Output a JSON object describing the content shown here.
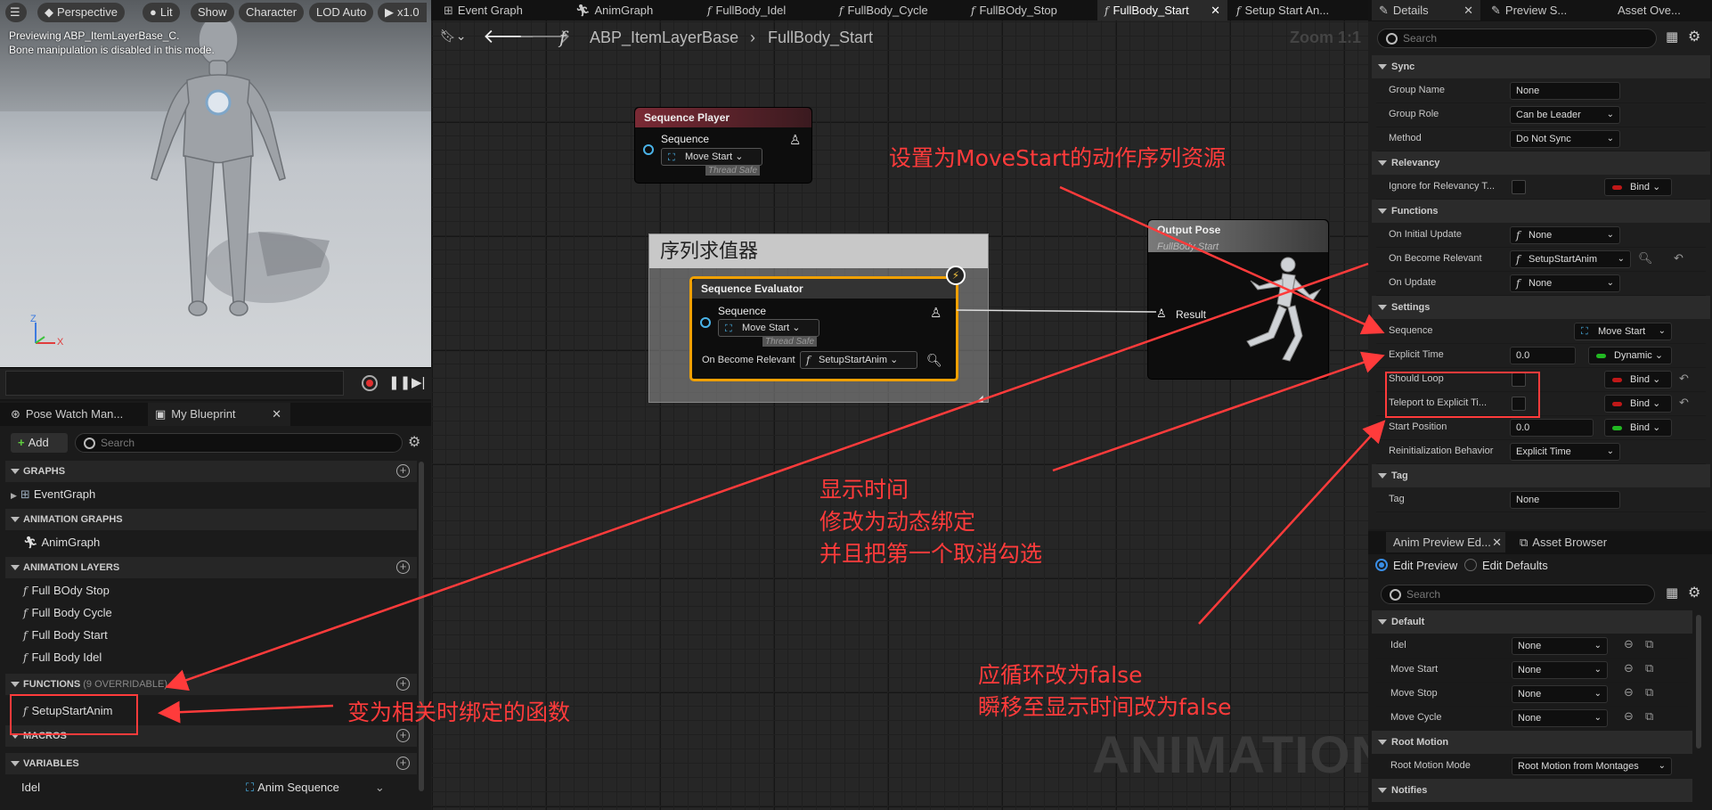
{
  "viewport": {
    "toolbar": [
      "Perspective",
      "Lit",
      "Show",
      "Character",
      "LOD Auto",
      "x1.0"
    ],
    "preview_line1": "Previewing ABP_ItemLayerBase_C.",
    "preview_line2": "Bone manipulation is disabled in this mode.",
    "axis_z": "Z",
    "axis_x": "X"
  },
  "left_panel": {
    "tabs": [
      "Pose Watch Man...",
      "My Blueprint"
    ],
    "add_label": "Add",
    "search_placeholder": "Search",
    "sections": {
      "graphs": "GRAPHS",
      "animation_graphs": "ANIMATION GRAPHS",
      "animation_layers": "ANIMATION LAYERS",
      "functions": "FUNCTIONS",
      "functions_note": "(9 OVERRIDABLE)",
      "macros": "MACROS",
      "variables": "VARIABLES"
    },
    "graphs": [
      "EventGraph"
    ],
    "animation_graphs": [
      "AnimGraph"
    ],
    "animation_layers": [
      "Full BOdy Stop",
      "Full Body Cycle",
      "Full Body Start",
      "Full Body Idel"
    ],
    "functions": [
      "SetupStartAnim"
    ],
    "variable": {
      "name": "Idel",
      "type": "Anim Sequence"
    }
  },
  "graph": {
    "tabs": [
      "Event Graph",
      "AnimGraph",
      "FullBody_Idel",
      "FullBody_Cycle",
      "FullBOdy_Stop",
      "FullBody_Start",
      "Setup Start An..."
    ],
    "breadcrumb": [
      "ABP_ItemLayerBase",
      "FullBody_Start"
    ],
    "zoom": "Zoom 1:1",
    "sequence_player": {
      "title": "Sequence Player",
      "pin": "Sequence",
      "value": "Move Start",
      "thread_safe": "Thread Safe"
    },
    "comment": "序列求值器",
    "evaluator": {
      "title": "Sequence Evaluator",
      "pin": "Sequence",
      "value": "Move Start",
      "thread_safe": "Thread Safe",
      "relevant_label": "On Become Relevant",
      "relevant_value": "SetupStartAnim"
    },
    "output_pose": {
      "title": "Output Pose",
      "subtitle": "FullBody Start",
      "pin": "Result"
    },
    "watermark": "ANIMATION"
  },
  "details": {
    "tabs": [
      "Details",
      "Preview S...",
      "Asset Ove..."
    ],
    "search_placeholder": "Search",
    "sync": {
      "header": "Sync",
      "group_name_label": "Group Name",
      "group_name": "None",
      "group_role_label": "Group Role",
      "group_role": "Can be Leader",
      "method_label": "Method",
      "method": "Do Not Sync"
    },
    "relevancy": {
      "header": "Relevancy",
      "ignore_label": "Ignore for Relevancy T...",
      "bind": "Bind"
    },
    "functions": {
      "header": "Functions",
      "initial_label": "On Initial Update",
      "initial": "None",
      "relevant_label": "On Become Relevant",
      "relevant": "SetupStartAnim",
      "update_label": "On Update",
      "update": "None"
    },
    "settings": {
      "header": "Settings",
      "sequence_label": "Sequence",
      "sequence": "Move Start",
      "explicit_label": "Explicit Time",
      "explicit_value": "0.0",
      "dynamic": "Dynamic",
      "loop_label": "Should Loop",
      "teleport_label": "Teleport to Explicit Ti...",
      "bind": "Bind",
      "start_label": "Start Position",
      "start_value": "0.0",
      "reinit_label": "Reinitialization Behavior",
      "reinit": "Explicit Time"
    },
    "tag": {
      "header": "Tag",
      "label": "Tag",
      "value": "None"
    }
  },
  "preview_panel": {
    "tabs": [
      "Anim Preview Ed...",
      "Asset Browser"
    ],
    "edit_preview": "Edit Preview",
    "edit_defaults": "Edit Defaults",
    "search_placeholder": "Search",
    "default_header": "Default",
    "rows": [
      {
        "label": "Idel",
        "value": "None"
      },
      {
        "label": "Move Start",
        "value": "None"
      },
      {
        "label": "Move Stop",
        "value": "None"
      },
      {
        "label": "Move Cycle",
        "value": "None"
      }
    ],
    "root_motion_header": "Root Motion",
    "root_motion_label": "Root Motion Mode",
    "root_motion_value": "Root Motion from Montages",
    "notifies_header": "Notifies"
  },
  "annotations": {
    "top": "设置为MoveStart的动作序列资源",
    "mid1": "显示时间",
    "mid2": "修改为动态绑定",
    "mid3": "并且把第一个取消勾选",
    "bottom1": "应循环改为false",
    "bottom2": "瞬移至显示时间改为false",
    "left": "变为相关时绑定的函数",
    "color": "#ff3b3b"
  }
}
